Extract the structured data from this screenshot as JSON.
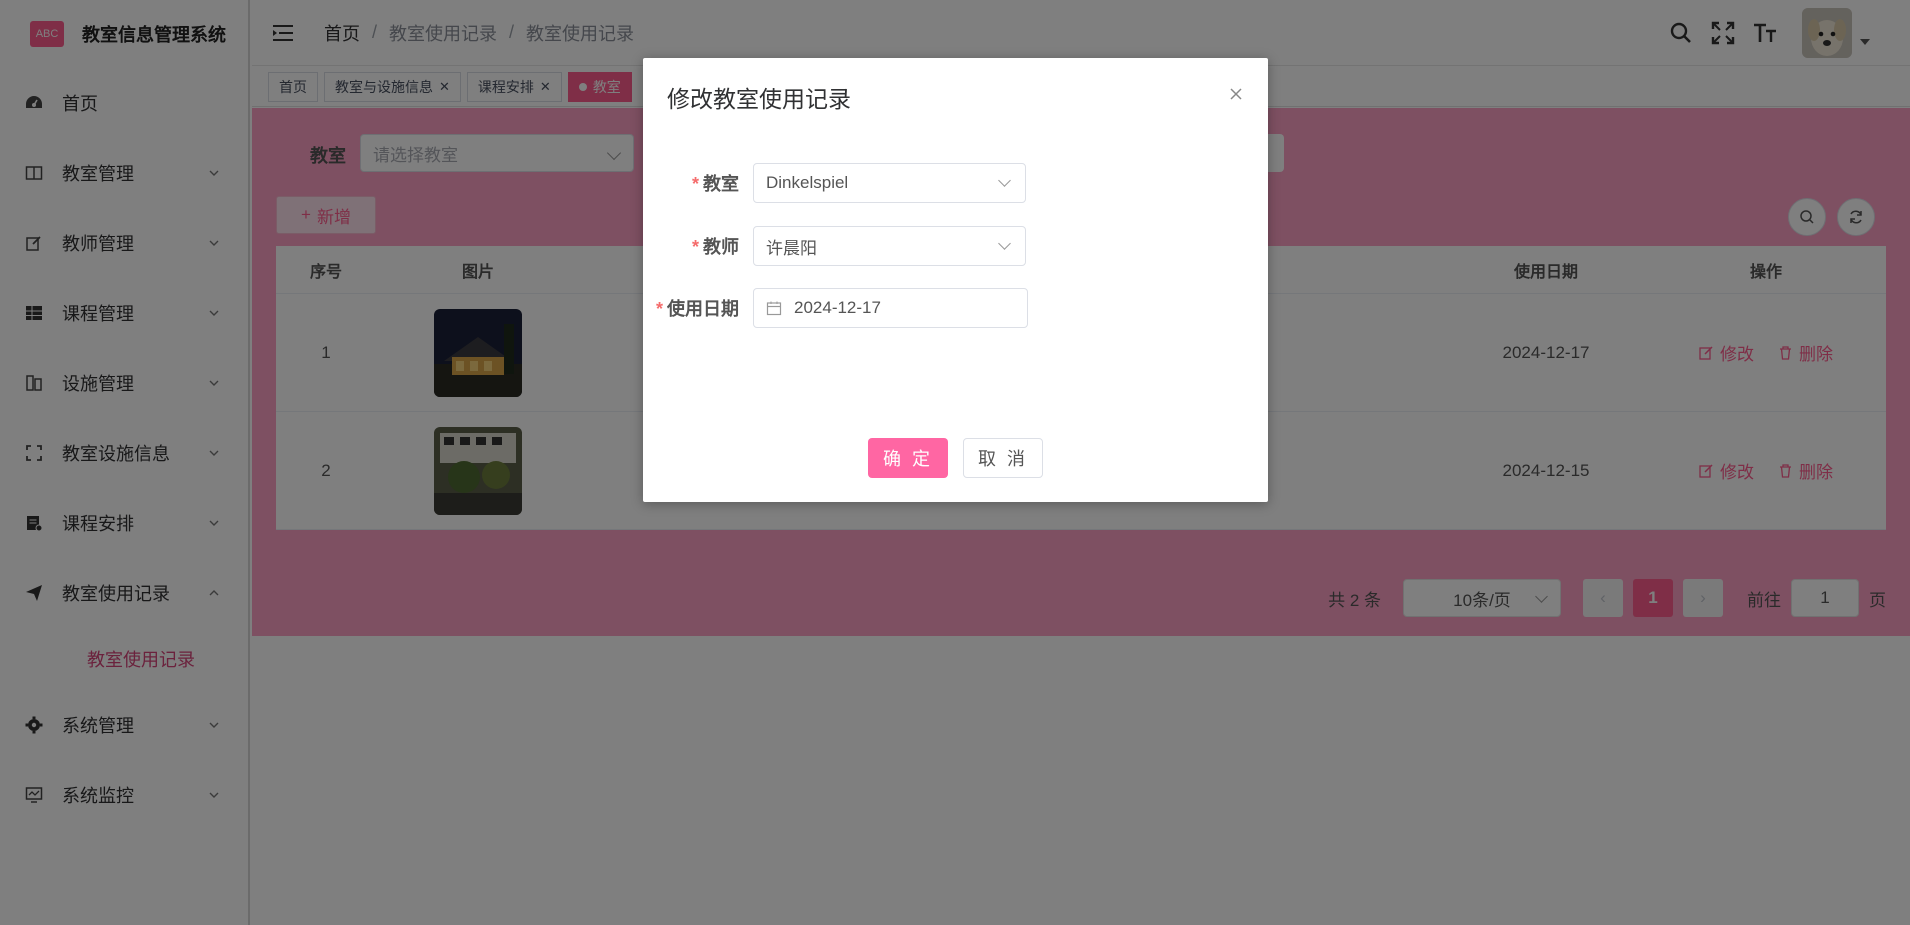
{
  "app": {
    "title": "教室信息管理系统",
    "logo_text": "ABC"
  },
  "sidebar": {
    "items": [
      {
        "label": "首页",
        "icon": "dashboard-icon"
      },
      {
        "label": "教室管理",
        "icon": "book-icon"
      },
      {
        "label": "教师管理",
        "icon": "edit-icon"
      },
      {
        "label": "课程管理",
        "icon": "table-icon"
      },
      {
        "label": "设施管理",
        "icon": "building-icon"
      },
      {
        "label": "教室设施信息",
        "icon": "fullscreen-icon"
      },
      {
        "label": "课程安排",
        "icon": "document-icon"
      },
      {
        "label": "教室使用记录",
        "icon": "send-icon"
      },
      {
        "label": "系统管理",
        "icon": "gear-icon"
      },
      {
        "label": "系统监控",
        "icon": "monitor-icon"
      }
    ],
    "sub_item": "教室使用记录"
  },
  "breadcrumb": [
    "首页",
    "教室使用记录",
    "教室使用记录"
  ],
  "tags": [
    {
      "label": "首页"
    },
    {
      "label": "教室与设施信息"
    },
    {
      "label": "课程安排"
    },
    {
      "label": "教室"
    }
  ],
  "search": {
    "label": "教室",
    "placeholder": "请选择教室"
  },
  "toolbar": {
    "add_label": "新增"
  },
  "table": {
    "headers": {
      "no": "序号",
      "image": "图片",
      "date": "使用日期",
      "ops": "操作"
    },
    "rows": [
      {
        "no": "1",
        "date": "2024-12-17"
      },
      {
        "no": "2",
        "date": "2024-12-15"
      }
    ],
    "edit_label": "修改",
    "delete_label": "删除"
  },
  "pagination": {
    "total": "共 2 条",
    "page_size": "10条/页",
    "current": "1",
    "goto_prefix": "前往",
    "goto_value": "1",
    "goto_suffix": "页"
  },
  "dialog": {
    "title": "修改教室使用记录",
    "fields": {
      "classroom": {
        "label": "教室",
        "value": "Dinkelspiel"
      },
      "teacher": {
        "label": "教师",
        "value": "许晨阳"
      },
      "date": {
        "label": "使用日期",
        "value": "2024-12-17"
      }
    },
    "confirm": "确 定",
    "cancel": "取 消"
  },
  "colors": {
    "accent": "#ff5d8f",
    "main_bg": "#fda0c4",
    "confirm": "#ff66a3"
  }
}
